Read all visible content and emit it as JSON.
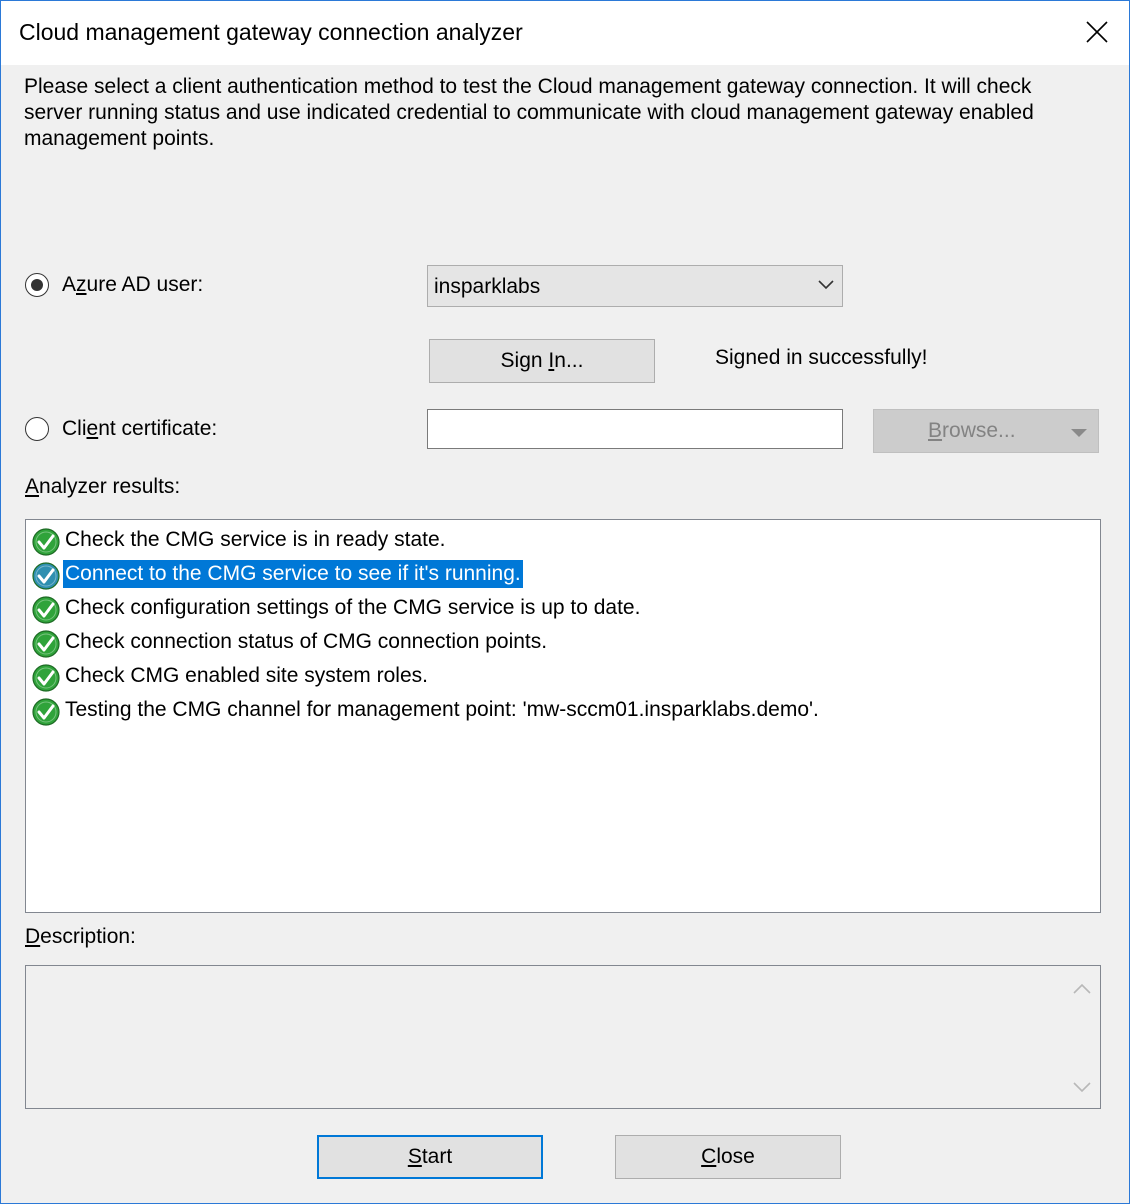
{
  "window": {
    "title": "Cloud management gateway connection analyzer"
  },
  "intro_text": "Please select a client authentication method to test the Cloud management gateway connection. It will check server running status and use indicated credential to communicate with cloud management gateway enabled management points.",
  "auth": {
    "azure_ad_label_pre": "A",
    "azure_ad_label_u": "z",
    "azure_ad_label_post": "ure AD user:",
    "azure_ad_selected": true,
    "azure_ad_account": "insparklabs",
    "sign_in_pre": "Sign ",
    "sign_in_u": "I",
    "sign_in_post": "n...",
    "sign_in_status": "Signed in successfully!",
    "client_cert_pre": "Cli",
    "client_cert_u": "e",
    "client_cert_post": "nt certificate:",
    "client_cert_value": "",
    "browse_pre": "",
    "browse_u": "B",
    "browse_post": "rowse..."
  },
  "results": {
    "label_u": "A",
    "label_post": "nalyzer results:",
    "items": [
      {
        "text": "Check the CMG service is in ready state.",
        "status": "success",
        "selected": false
      },
      {
        "text": "Connect to the CMG service to see if it's running.",
        "status": "success",
        "selected": true
      },
      {
        "text": "Check configuration settings of the CMG service is up to date.",
        "status": "success",
        "selected": false
      },
      {
        "text": "Check connection status of CMG connection points.",
        "status": "success",
        "selected": false
      },
      {
        "text": "Check CMG enabled site system roles.",
        "status": "success",
        "selected": false
      },
      {
        "text": "Testing the CMG channel for management point: 'mw-sccm01.insparklabs.demo'.",
        "status": "success",
        "selected": false
      }
    ]
  },
  "description": {
    "label_u": "D",
    "label_post": "escription:",
    "value": ""
  },
  "buttons": {
    "start_u": "S",
    "start_post": "tart",
    "close_u": "C",
    "close_post": "lose"
  },
  "colors": {
    "selection": "#0078d7",
    "success_green": "#2fa33a",
    "accent_border": "#2b79d7"
  }
}
